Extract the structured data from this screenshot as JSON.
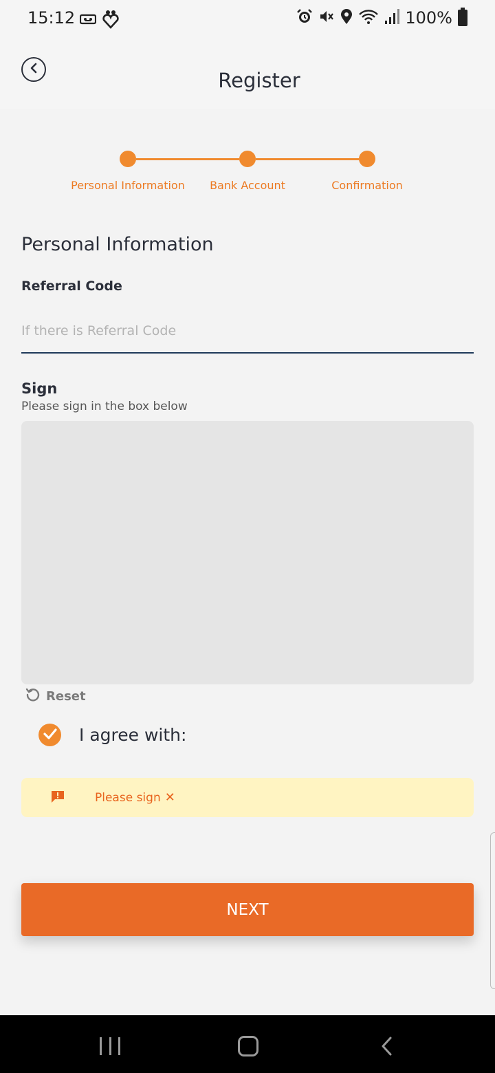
{
  "status_bar": {
    "time": "15:12",
    "battery_text": "100%",
    "left_icons": [
      "voicemail-icon",
      "hearts-icon"
    ],
    "right_icons": [
      "alarm-icon",
      "mute-icon",
      "location-icon",
      "wifi-icon",
      "signal-icon",
      "battery-icon"
    ]
  },
  "header": {
    "title": "Register"
  },
  "stepper": {
    "steps": [
      {
        "label": "Personal Information"
      },
      {
        "label": "Bank Account"
      },
      {
        "label": "Confirmation"
      }
    ]
  },
  "form": {
    "section_title": "Personal Information",
    "referral_label": "Referral Code",
    "referral_value": "",
    "referral_placeholder": "If there is Referral Code",
    "sign_label": "Sign",
    "sign_help": "Please sign in the box below",
    "reset_label": "Reset",
    "agree_label": "I agree with:",
    "agree_checked": true
  },
  "alert": {
    "text": "Please sign",
    "close_glyph": "✕"
  },
  "actions": {
    "next_label": "NEXT"
  },
  "colors": {
    "accent": "#f08a2e",
    "button": "#e96a27",
    "alert_bg": "#fff4c2",
    "alert_text": "#e8641e"
  }
}
